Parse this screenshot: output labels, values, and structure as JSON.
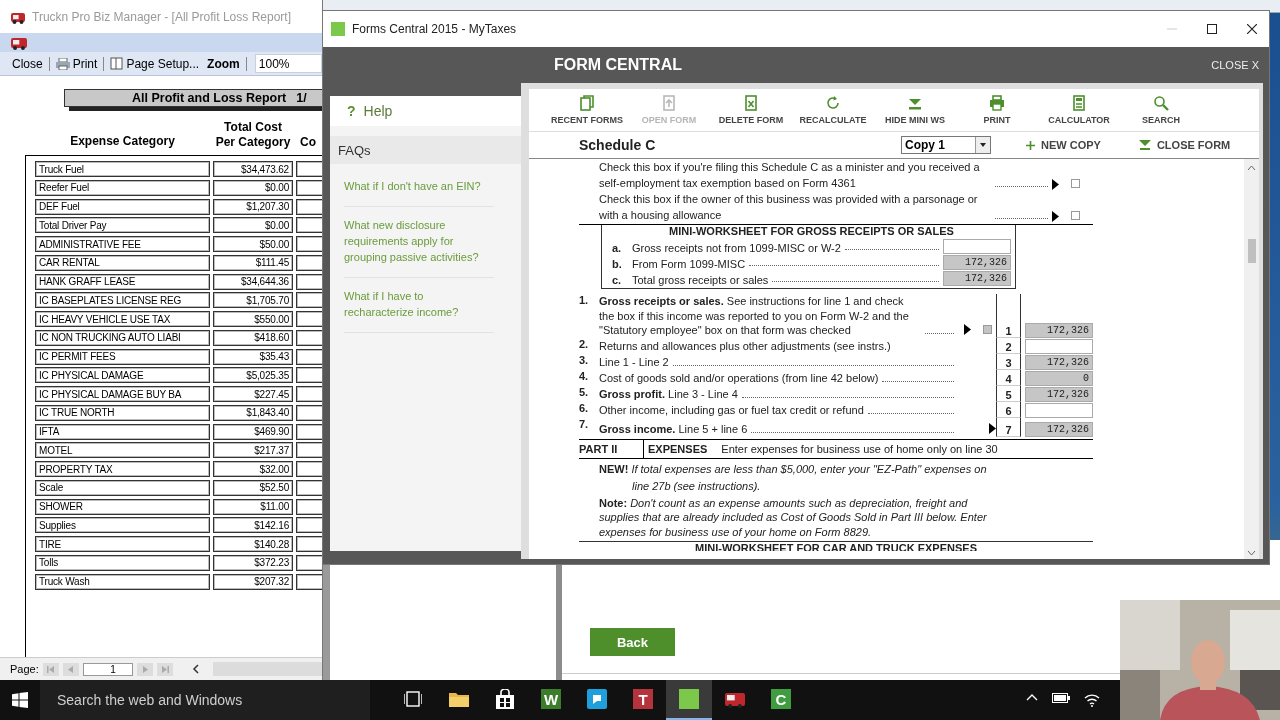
{
  "report_window": {
    "title": "Truckn Pro Biz Manager - [All Profit Loss Report]",
    "toolbar": [
      {
        "kind": "close",
        "label": "Close"
      },
      {
        "kind": "print",
        "label": "Print"
      },
      {
        "kind": "page_setup",
        "label": "Page Setup..."
      },
      {
        "kind": "zoom_label",
        "label": "Zoom"
      }
    ],
    "zoom_value": "100%",
    "report_title": "All Profit and Loss Report",
    "report_page": "1/",
    "columns": [
      "Expense Category",
      "Total Cost Per Category",
      "Co"
    ],
    "rows": [
      {
        "category": "Truck Fuel",
        "total": "$34,473.62"
      },
      {
        "category": "Reefer Fuel",
        "total": "$0.00"
      },
      {
        "category": "DEF Fuel",
        "total": "$1,207.30"
      },
      {
        "category": "Total Driver Pay",
        "total": "$0.00"
      },
      {
        "category": "ADMINISTRATIVE FEE",
        "total": "$50.00"
      },
      {
        "category": "CAR RENTAL",
        "total": "$111.45"
      },
      {
        "category": "HANK GRAFF LEASE",
        "total": "$34,644.36"
      },
      {
        "category": "IC BASEPLATES LICENSE REG",
        "total": "$1,705.70"
      },
      {
        "category": "IC HEAVY VEHICLE USE TAX",
        "total": "$550.00"
      },
      {
        "category": "IC NON TRUCKING AUTO LIABI",
        "total": "$418.60"
      },
      {
        "category": "IC PERMIT FEES",
        "total": "$35.43"
      },
      {
        "category": "IC PHYSICAL DAMAGE",
        "total": "$5,025.35"
      },
      {
        "category": "IC PHYSICAL DAMAGE BUY BA",
        "total": "$227.45"
      },
      {
        "category": "IC TRUE NORTH",
        "total": "$1,843.40"
      },
      {
        "category": "IFTA",
        "total": "$469.90"
      },
      {
        "category": "MOTEL",
        "total": "$217.37"
      },
      {
        "category": "PROPERTY TAX",
        "total": "$32.00"
      },
      {
        "category": "Scale",
        "total": "$52.50"
      },
      {
        "category": "SHOWER",
        "total": "$11.00"
      },
      {
        "category": "Supplies",
        "total": "$142.16"
      },
      {
        "category": "TIRE",
        "total": "$140.28"
      },
      {
        "category": "Tolls",
        "total": "$372.23"
      },
      {
        "category": "Truck Wash",
        "total": "$207.32"
      }
    ],
    "pager": {
      "label": "Page:",
      "page": "1"
    }
  },
  "forms_window": {
    "title": "Forms Central 2015 - MyTaxes",
    "header": "FORM CENTRAL",
    "close_link": "CLOSE X",
    "help": {
      "icon": "?",
      "label": "Help"
    },
    "faqs": {
      "title": "FAQs",
      "links": [
        "What if I don't have an EIN?",
        "What new disclosure requirements apply for grouping passive activities?",
        "What if I have to recharacterize income?"
      ]
    },
    "toolbar": [
      {
        "kind": "recent",
        "label": "RECENT FORMS",
        "disabled": false
      },
      {
        "kind": "open",
        "label": "OPEN FORM",
        "disabled": true
      },
      {
        "kind": "delete",
        "label": "DELETE FORM",
        "disabled": false
      },
      {
        "kind": "recalc",
        "label": "RECALCULATE",
        "disabled": false
      },
      {
        "kind": "hide",
        "label": "HIDE MINI WS",
        "disabled": false
      },
      {
        "kind": "print",
        "label": "PRINT",
        "disabled": false
      },
      {
        "kind": "calculator",
        "label": "CALCULATOR",
        "disabled": false
      },
      {
        "kind": "search",
        "label": "SEARCH",
        "disabled": false
      }
    ],
    "form_name": "Schedule C",
    "copy_select": "Copy 1",
    "new_copy": "NEW COPY",
    "close_form": "CLOSE FORM",
    "check_rows": [
      {
        "text": "Check this box if you're filing this Schedule C as a minister and you received a self-employment tax exemption based on Form 4361",
        "checked": false
      },
      {
        "text": "Check this box if the owner of this business was provided with a parsonage or with a housing allowance",
        "checked": false
      }
    ],
    "mini_worksheet": {
      "title": "MINI-WORKSHEET FOR GROSS RECEIPTS OR SALES",
      "rows": [
        {
          "letter": "a.",
          "text": "Gross receipts not from 1099-MISC or W-2",
          "kind": "input"
        },
        {
          "letter": "b.",
          "text": "From Form 1099-MISC",
          "value": "172,326",
          "kind": "calc"
        },
        {
          "letter": "c.",
          "text": "Total gross receipts or sales",
          "value": "172,326",
          "kind": "calc"
        }
      ]
    },
    "lines": [
      {
        "number": "1.",
        "text": "**Gross receipts or sales.** See instructions for line 1 and check the box if this income was reported to you on Form W-2 and the \"Statutory employee\" box on that form was checked",
        "line": "1",
        "value": "172,326",
        "kind": "calc",
        "leader": true,
        "arrow": true,
        "checkbox": {
          "checked": false,
          "disabled": true
        }
      },
      {
        "number": "2.",
        "text": "Returns and allowances plus other adjustments (see instrs.)",
        "line": "2",
        "kind": "input",
        "leader": false,
        "arrow": false
      },
      {
        "number": "3.",
        "text": "Line 1 - Line 2",
        "line": "3",
        "value": "172,326",
        "kind": "calc",
        "leader": true,
        "arrow": false
      },
      {
        "number": "4.",
        "text": "Cost of goods sold and/or operations (from line 42 below)",
        "line": "4",
        "value": "0",
        "kind": "calc",
        "leader": true,
        "arrow": false
      },
      {
        "number": "5.",
        "text": "**Gross profit.** Line 3 - Line 4",
        "line": "5",
        "value": "172,326",
        "kind": "calc",
        "leader": true,
        "arrow": false
      },
      {
        "number": "6.",
        "text": "Other income, including gas or fuel tax credit or refund",
        "line": "6",
        "kind": "input",
        "leader": true,
        "arrow": false
      },
      {
        "number": "7.",
        "text": "**Gross income.** Line 5 + line 6",
        "line": "7",
        "value": "172,326",
        "kind": "calc",
        "leader": true,
        "arrow": true
      }
    ],
    "part": {
      "label": "PART II",
      "title": "EXPENSES",
      "text": "Enter expenses for business use of home only on line 30"
    },
    "notes": [
      "**NEW!** *If total expenses are less than $5,000, enter your \"EZ-Path\" expenses on line 27b (see instructions).*",
      "**Note:** *Don't count as an expense amounts such as depreciation, freight and supplies that are already included as Cost of Goods Sold in Part III below. Enter expenses for business use of your home on Form 8829.*"
    ],
    "next_heading": "MINI-WORKSHEET FOR CAR AND TRUCK EXPENSES"
  },
  "back_window": {
    "back_button": "Back"
  },
  "taskbar": {
    "search": {
      "placeholder": "Search the web and Windows"
    },
    "apps": [
      {
        "kind": "taskview",
        "selected": false
      },
      {
        "kind": "explorer",
        "selected": false
      },
      {
        "kind": "store",
        "selected": false
      },
      {
        "kind": "letter",
        "glyph": "W",
        "color": "#3b7d2a",
        "selected": false
      },
      {
        "kind": "chat",
        "selected": false
      },
      {
        "kind": "letter",
        "glyph": "T",
        "color": "#b5333d",
        "selected": false
      },
      {
        "kind": "forms",
        "selected": true
      },
      {
        "kind": "truck",
        "selected": false
      },
      {
        "kind": "letter",
        "glyph": "C",
        "color": "#3f9d3f",
        "selected": false
      }
    ]
  }
}
